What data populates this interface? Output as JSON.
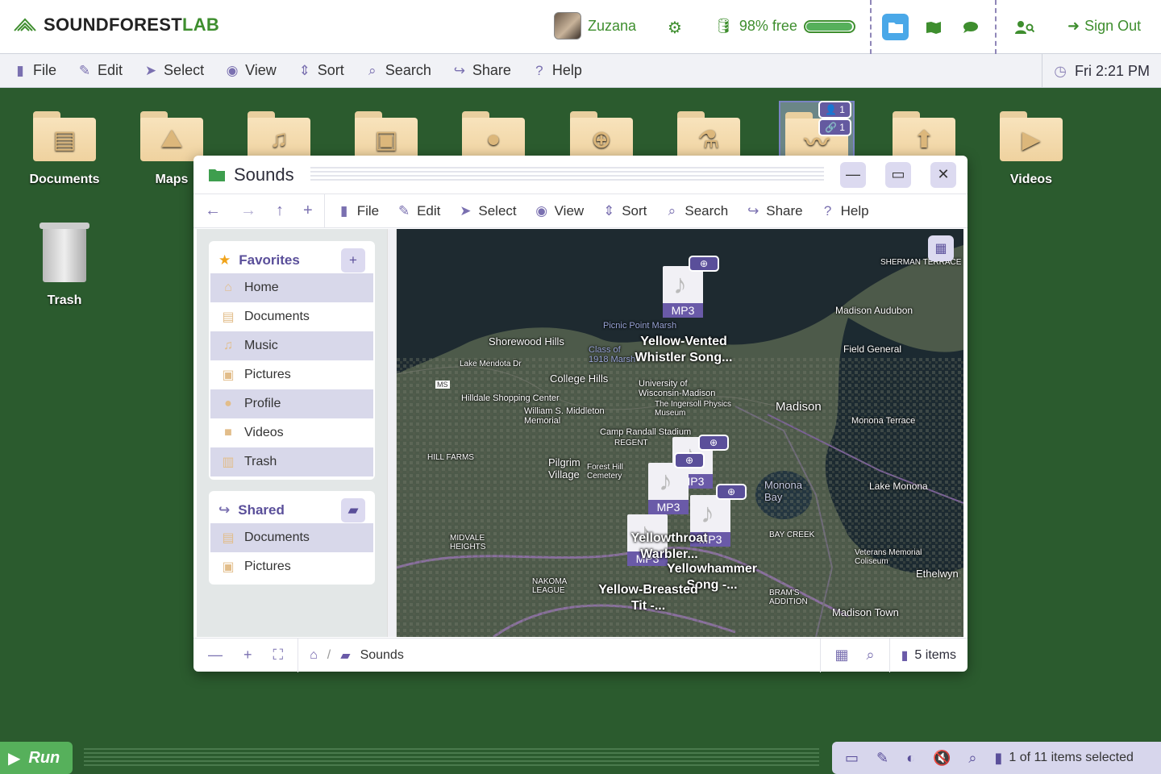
{
  "app": {
    "logo_a": "SOUNDFOREST",
    "logo_b": "LAB"
  },
  "user": {
    "name": "Zuzana"
  },
  "storage": {
    "label": "98% free",
    "free_fraction": 0.98
  },
  "topbar": {
    "signout": "Sign Out"
  },
  "menu": {
    "file": "File",
    "edit": "Edit",
    "select": "Select",
    "view": "View",
    "sort": "Sort",
    "search": "Search",
    "share": "Share",
    "help": "Help"
  },
  "clock": "Fri 2:21 PM",
  "desktop": [
    {
      "label": "Documents",
      "icon": "document-icon"
    },
    {
      "label": "Maps",
      "icon": "map-icon"
    },
    {
      "label": "",
      "icon": "music-icon"
    },
    {
      "label": "",
      "icon": "camera-icon"
    },
    {
      "label": "",
      "icon": "person-icon"
    },
    {
      "label": "",
      "icon": "globe-icon"
    },
    {
      "label": "",
      "icon": "flask-icon"
    },
    {
      "label": "",
      "icon": "waveform-icon"
    },
    {
      "label": "",
      "icon": "upload-icon"
    },
    {
      "label": "Videos",
      "icon": "video-icon"
    },
    {
      "label": "Trash",
      "icon": "trash-icon"
    }
  ],
  "sounds_badges": {
    "users": "1",
    "links": "1"
  },
  "window": {
    "title": "Sounds"
  },
  "sidebar": {
    "favorites_title": "Favorites",
    "favorites": [
      "Home",
      "Documents",
      "Music",
      "Pictures",
      "Profile",
      "Videos",
      "Trash"
    ],
    "shared_title": "Shared",
    "shared": [
      "Documents",
      "Pictures"
    ]
  },
  "map": {
    "labels": [
      "SHERMAN TERRACE",
      "Madison Audubon",
      "Shorewood Hills",
      "Field General",
      "College Hills",
      "Lake Mendota Dr",
      "University of Wisconsin-Madison",
      "Hilldale Shopping Center",
      "The Ingersoll Physics Museum",
      "Madison",
      "Monona Terrace",
      "William S. Middleton Memorial",
      "Camp Randall Stadium",
      "REGENT",
      "HILL FARMS",
      "Pilgrim Village",
      "Forest Hill Cemetery",
      "Monona Bay",
      "Lake Monona",
      "MIDVALE HEIGHTS",
      "BAY CREEK",
      "Veterans Memorial Coliseum",
      "NAKOMA LEAGUE",
      "BRAM'S ADDITION",
      "Ethelwyn",
      "Madison Town",
      "Picnic Point Marsh",
      "Class of 1918 Marsh",
      "MS"
    ],
    "files": [
      {
        "label": "Yellow-Vented Whistler Song...",
        "type": "MP3"
      },
      {
        "label": "Yellowthroat Warbler...",
        "type": "MP3"
      },
      {
        "label": "Yellowhammer Song -...",
        "type": "MP3"
      },
      {
        "label": "Yellow-Breasted Tit -...",
        "type": "MP3"
      },
      {
        "label": "",
        "type": "MP3"
      }
    ]
  },
  "statusbar": {
    "crumb": "Sounds",
    "items": "5 items"
  },
  "bottom": {
    "run": "Run",
    "selection": "1 of 11 items selected"
  }
}
